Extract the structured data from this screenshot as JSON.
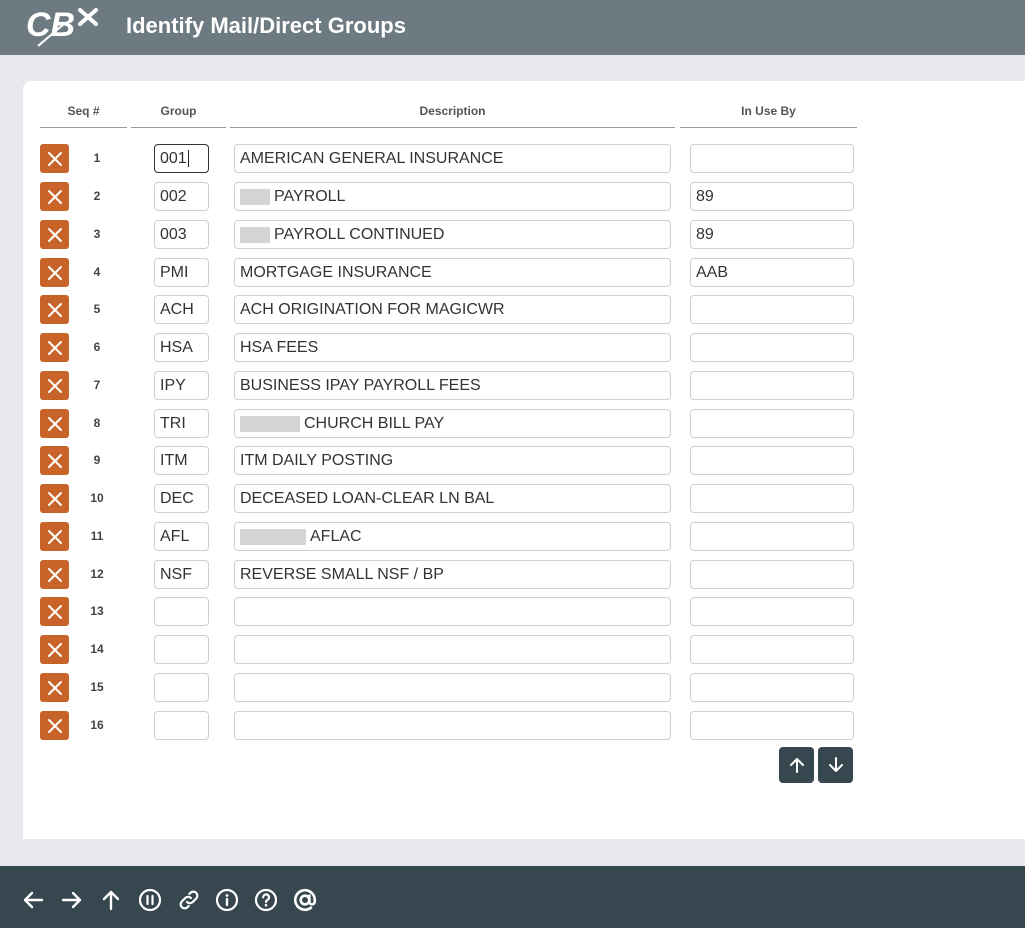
{
  "app": {
    "logo_text": "CBX",
    "title": "Identify Mail/Direct Groups"
  },
  "colors": {
    "topbar": "#6e7a82",
    "accent_delete": "#c8642a",
    "dark": "#36474f"
  },
  "table": {
    "headers": {
      "seq": "Seq #",
      "group": "Group",
      "description": "Description",
      "in_use_by": "In Use By"
    },
    "rows": [
      {
        "seq": "1",
        "group": "001",
        "description": "AMERICAN GENERAL INSURANCE",
        "in_use_by": ""
      },
      {
        "seq": "2",
        "group": "002",
        "description": "PAYROLL",
        "in_use_by": "89"
      },
      {
        "seq": "3",
        "group": "003",
        "description": "PAYROLL CONTINUED",
        "in_use_by": "89"
      },
      {
        "seq": "4",
        "group": "PMI",
        "description": "MORTGAGE INSURANCE",
        "in_use_by": "AAB"
      },
      {
        "seq": "5",
        "group": "ACH",
        "description": "ACH ORIGINATION FOR MAGICWR",
        "in_use_by": ""
      },
      {
        "seq": "6",
        "group": "HSA",
        "description": "HSA FEES",
        "in_use_by": ""
      },
      {
        "seq": "7",
        "group": "IPY",
        "description": "BUSINESS IPAY PAYROLL FEES",
        "in_use_by": ""
      },
      {
        "seq": "8",
        "group": "TRI",
        "description": "CHURCH BILL PAY",
        "in_use_by": ""
      },
      {
        "seq": "9",
        "group": "ITM",
        "description": "ITM DAILY POSTING",
        "in_use_by": ""
      },
      {
        "seq": "10",
        "group": "DEC",
        "description": "DECEASED LOAN-CLEAR LN BAL",
        "in_use_by": ""
      },
      {
        "seq": "11",
        "group": "AFL",
        "description": "AFLAC",
        "in_use_by": ""
      },
      {
        "seq": "12",
        "group": "NSF",
        "description": "REVERSE SMALL NSF / BP",
        "in_use_by": ""
      },
      {
        "seq": "13",
        "group": "",
        "description": "",
        "in_use_by": ""
      },
      {
        "seq": "14",
        "group": "",
        "description": "",
        "in_use_by": ""
      },
      {
        "seq": "15",
        "group": "",
        "description": "",
        "in_use_by": ""
      },
      {
        "seq": "16",
        "group": "",
        "description": "",
        "in_use_by": ""
      }
    ]
  },
  "icons": {
    "delete": "close-icon",
    "page_up": "arrow-up-icon",
    "page_down": "arrow-down-icon",
    "footer": [
      "arrow-left-icon",
      "arrow-right-icon",
      "arrow-up-icon",
      "pause-icon",
      "link-icon",
      "info-icon",
      "help-icon",
      "at-sign-icon"
    ]
  }
}
